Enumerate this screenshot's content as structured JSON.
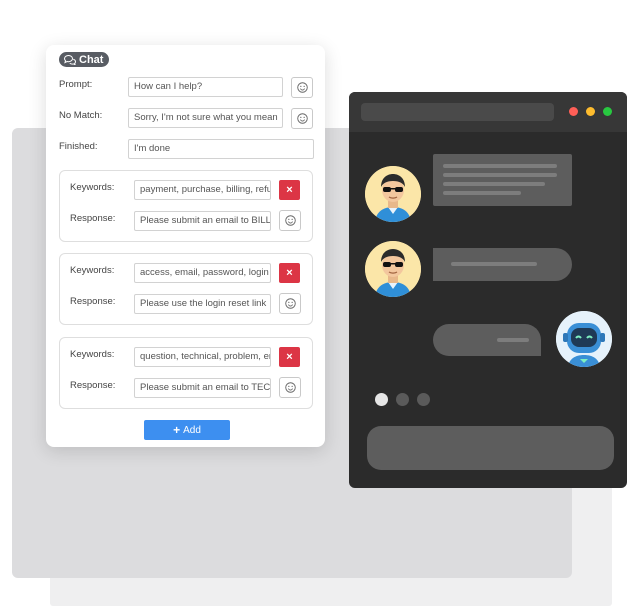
{
  "chat_panel": {
    "badge_label": "Chat",
    "prompt": {
      "label": "Prompt:",
      "value": "How can I help?"
    },
    "no_match": {
      "label": "No Match:",
      "value": "Sorry, I'm not sure what you mean"
    },
    "finished": {
      "label": "Finished:",
      "value": "I'm done"
    },
    "rules": [
      {
        "keywords_label": "Keywords:",
        "keywords_value": "payment, purchase, billing, refund",
        "response_label": "Response:",
        "response_value": "Please submit an email to BILLING"
      },
      {
        "keywords_label": "Keywords:",
        "keywords_value": "access, email, password, login",
        "response_label": "Response:",
        "response_value": "Please use the login reset link"
      },
      {
        "keywords_label": "Keywords:",
        "keywords_value": "question, technical, problem, error",
        "response_label": "Response:",
        "response_value": "Please submit an email to TECH"
      }
    ],
    "add_label": "Add",
    "delete_glyph": "×",
    "colors": {
      "delete": "#dc3545",
      "add": "#3d8ff0",
      "badge": "#585c63"
    }
  },
  "chat_window": {
    "theme": "dark",
    "window_dots": [
      "#ff5f57",
      "#febc2e",
      "#28c840"
    ],
    "typing_dots": [
      "#e6e6e6",
      "#5a5a5a",
      "#5a5a5a"
    ],
    "icons": [
      "user-avatar-icon",
      "bot-avatar-icon"
    ]
  }
}
